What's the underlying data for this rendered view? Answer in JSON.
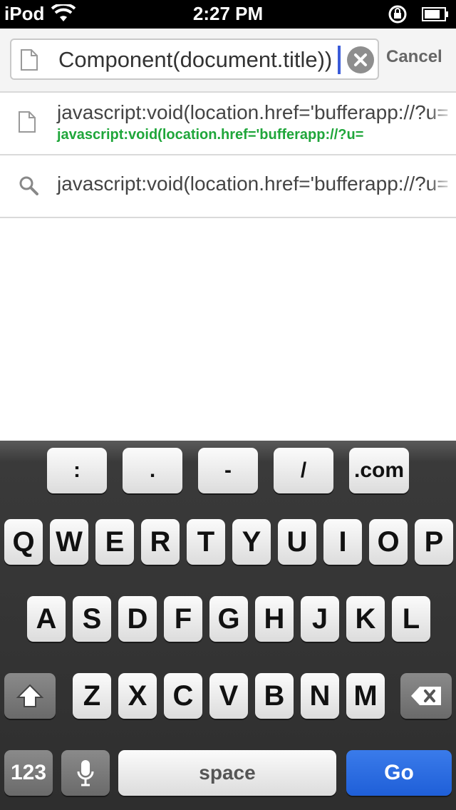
{
  "status": {
    "carrier": "iPod",
    "time": "2:27 PM"
  },
  "search": {
    "url_text": "Component(document.title))",
    "cancel_label": "Cancel"
  },
  "suggestions": [
    {
      "icon": "page-icon",
      "title": "javascript:void(location.href='bufferapp://?u=",
      "subtitle": "javascript:void(location.href='bufferapp://?u="
    },
    {
      "icon": "search-icon",
      "title": "javascript:void(location.href='bufferapp://?u="
    }
  ],
  "keyboard": {
    "symbol_row": [
      ":",
      ".",
      "-",
      "/",
      ".com"
    ],
    "row1": [
      "Q",
      "W",
      "E",
      "R",
      "T",
      "Y",
      "U",
      "I",
      "O",
      "P"
    ],
    "row2": [
      "A",
      "S",
      "D",
      "F",
      "G",
      "H",
      "J",
      "K",
      "L"
    ],
    "row3": [
      "Z",
      "X",
      "C",
      "V",
      "B",
      "N",
      "M"
    ],
    "numbers_label": "123",
    "space_label": "space",
    "go_label": "Go"
  },
  "colors": {
    "accent": "#1f5fd8",
    "suggestion_url": "#1fa63a",
    "caret": "#3a5bd9"
  }
}
